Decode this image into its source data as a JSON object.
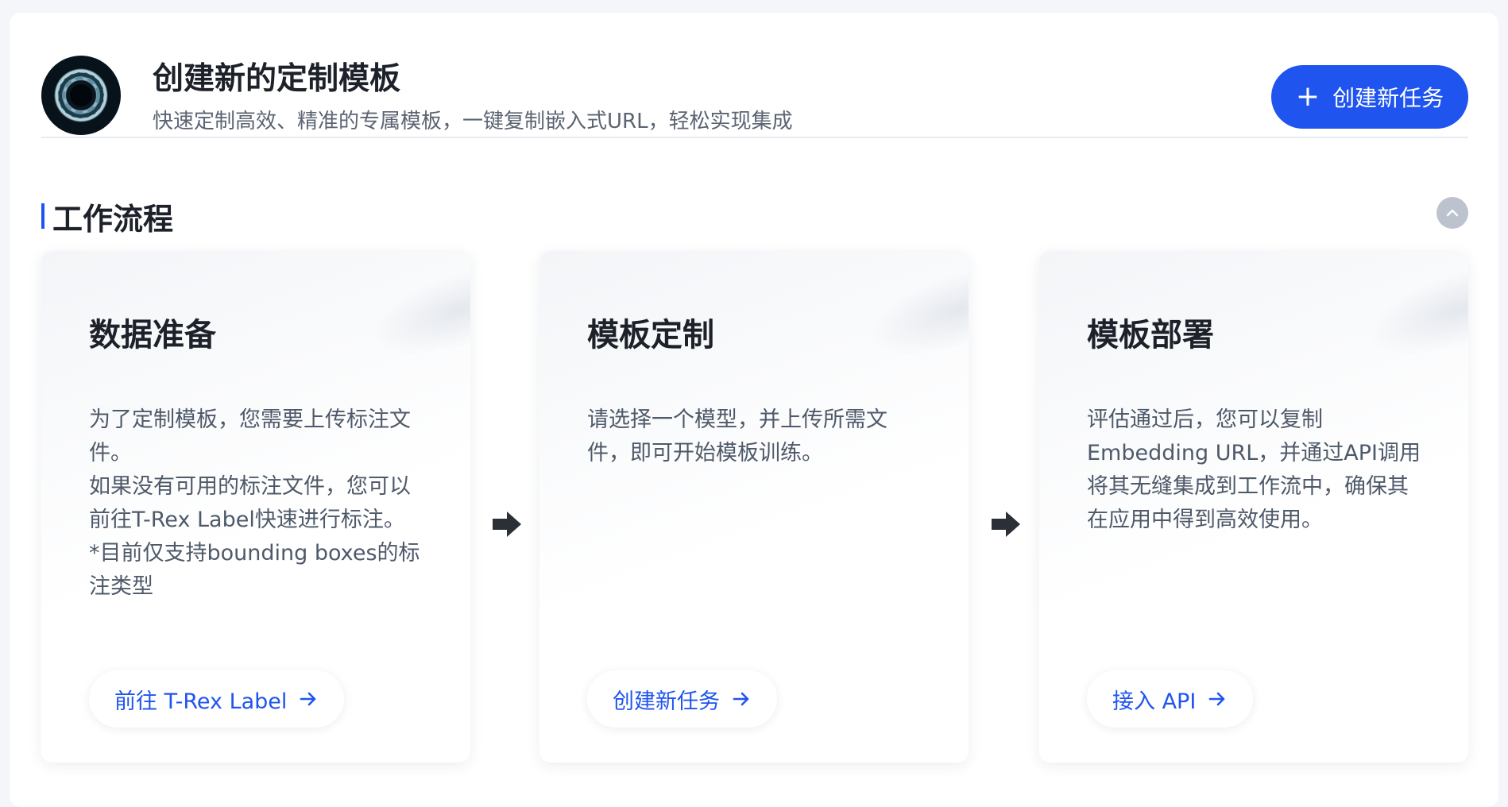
{
  "header": {
    "title": "创建新的定制模板",
    "subtitle": "快速定制高效、精准的专属模板，一键复制嵌入式URL，轻松实现集成",
    "create_button": "创建新任务",
    "avatar_icon": "portal-ring-avatar"
  },
  "workflow": {
    "section_title": "工作流程",
    "collapse_icon": "chevron-up-icon",
    "cards": [
      {
        "title": "数据准备",
        "desc_lines": [
          "为了定制模板，您需要上传标注文件。",
          "如果没有可用的标注文件，您可以前往T-Rex Label快速进行标注。",
          "*目前仅支持bounding boxes的标注类型"
        ],
        "link_label": "前往 T-Rex Label"
      },
      {
        "title": "模板定制",
        "desc_lines": [
          "请选择一个模型，并上传所需文件，即可开始模板训练。"
        ],
        "link_label": "创建新任务"
      },
      {
        "title": "模板部署",
        "desc_lines": [
          "评估通过后，您可以复制Embedding URL，并通过API调用将其无缝集成到工作流中，确保其在应用中得到高效使用。"
        ],
        "link_label": "接入 API"
      }
    ]
  },
  "colors": {
    "accent": "#1f54ee",
    "title_text": "#1d2129",
    "body_text": "#4e5969",
    "collapse_button": "#bcc3cf"
  }
}
